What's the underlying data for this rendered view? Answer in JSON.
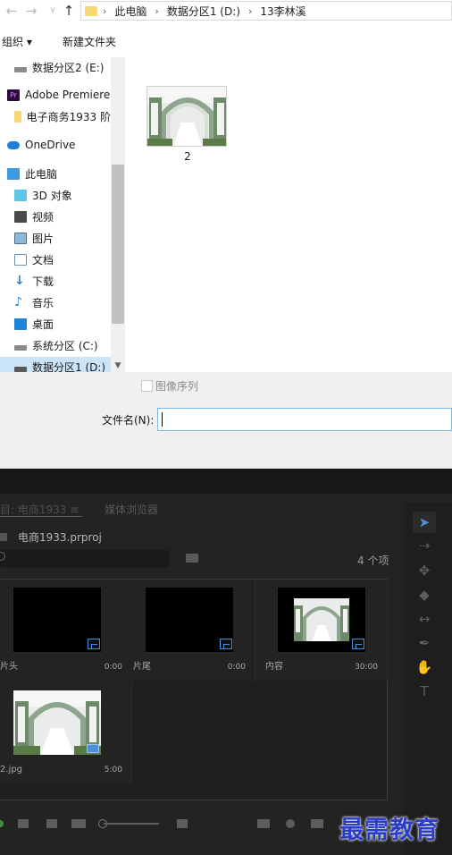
{
  "address_bar": {
    "crumbs": [
      "此电脑",
      "数据分区1 (D:)",
      "13李林溪"
    ]
  },
  "toolbar": {
    "organize_label": "组织 ▾",
    "new_folder_label": "新建文件夹"
  },
  "tree": {
    "items": [
      {
        "label": "数据分区2 (E:)",
        "icon": "drive-icon"
      },
      {
        "label": "Adobe Premiere",
        "icon": "premiere-icon"
      },
      {
        "label": "电子商务1933 阶",
        "icon": "folder-icon"
      },
      {
        "label": "OneDrive",
        "icon": "cloud-icon"
      },
      {
        "label": "此电脑",
        "icon": "computer-icon"
      },
      {
        "label": "3D 对象",
        "icon": "cube-icon"
      },
      {
        "label": "视频",
        "icon": "video-icon"
      },
      {
        "label": "图片",
        "icon": "picture-icon"
      },
      {
        "label": "文档",
        "icon": "document-icon"
      },
      {
        "label": "下载",
        "icon": "download-icon"
      },
      {
        "label": "音乐",
        "icon": "music-icon"
      },
      {
        "label": "桌面",
        "icon": "desktop-icon"
      },
      {
        "label": "系统分区 (C:)",
        "icon": "drive-icon"
      },
      {
        "label": "数据分区1 (D:)",
        "icon": "drive-icon"
      }
    ],
    "selected": "数据分区1 (D:)"
  },
  "files": [
    {
      "name": "2"
    }
  ],
  "dialog": {
    "image_sequence_label": "图像序列",
    "image_sequence_checked": false,
    "filename_label": "文件名(N):",
    "filename_value": ""
  },
  "premiere": {
    "tab_project": "目: 电商1933 ≡",
    "tab_media": "媒体浏览器",
    "project_name": "电商1933.prproj",
    "item_count": "4 个项",
    "bins": [
      {
        "name": "片头",
        "duration": "0:00",
        "type": "sequence"
      },
      {
        "name": "片尾",
        "duration": "0:00",
        "type": "sequence"
      },
      {
        "name": "内容",
        "duration": "30:00",
        "type": "sequence"
      },
      {
        "name": "2.jpg",
        "duration": "5:00",
        "type": "image"
      }
    ],
    "tools": [
      "selection-tool",
      "track-select-tool",
      "ripple-edit-tool",
      "razor-tool",
      "slip-tool",
      "pen-tool",
      "hand-tool",
      "type-tool"
    ]
  },
  "watermark": "最需教育",
  "colors": {
    "accent": "#4d8fd6",
    "selection": "#cce4f7",
    "premiere_bg": "#232323"
  }
}
